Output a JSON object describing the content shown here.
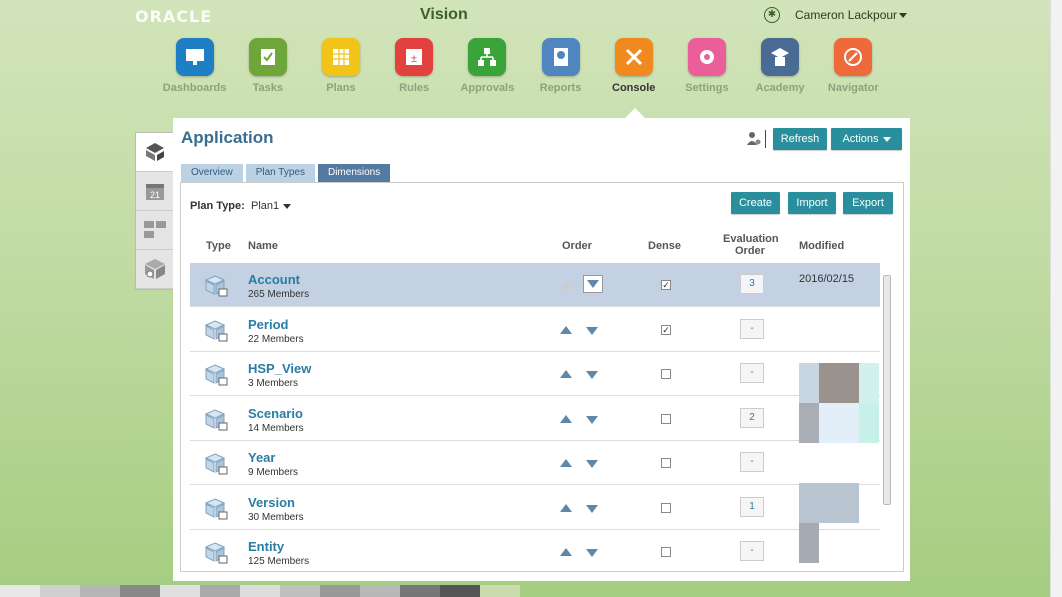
{
  "header": {
    "logo": "ORACLE",
    "app_title": "Vision",
    "user_name": "Cameron Lackpour"
  },
  "nav": [
    {
      "label": "Dashboards",
      "color": "#1f7fc4",
      "icon": "dashboard-icon"
    },
    {
      "label": "Tasks",
      "color": "#6ea63a",
      "icon": "tasks-icon"
    },
    {
      "label": "Plans",
      "color": "#f2c318",
      "icon": "plans-icon"
    },
    {
      "label": "Rules",
      "color": "#e2413e",
      "icon": "rules-icon"
    },
    {
      "label": "Approvals",
      "color": "#3aa33a",
      "icon": "approvals-icon"
    },
    {
      "label": "Reports",
      "color": "#4f86c0",
      "icon": "reports-icon"
    },
    {
      "label": "Console",
      "color": "#f08a1e",
      "icon": "console-icon",
      "active": true
    },
    {
      "label": "Settings",
      "color": "#ea5f9a",
      "icon": "settings-icon"
    },
    {
      "label": "Academy",
      "color": "#4a6b93",
      "icon": "academy-icon"
    },
    {
      "label": "Navigator",
      "color": "#ee6a3a",
      "icon": "navigator-icon"
    }
  ],
  "panel": {
    "title": "Application",
    "refresh_label": "Refresh",
    "actions_label": "Actions",
    "tabs": [
      "Overview",
      "Plan Types",
      "Dimensions"
    ],
    "active_tab": "Dimensions",
    "create_label": "Create",
    "import_label": "Import",
    "export_label": "Export",
    "plan_type_label": "Plan Type",
    "plan_type_value": "Plan1"
  },
  "grid": {
    "columns": {
      "type": "Type",
      "name": "Name",
      "order": "Order",
      "dense": "Dense",
      "eval_line1": "Evaluation",
      "eval_line2": "Order",
      "modified": "Modified"
    },
    "rows": [
      {
        "name": "Account",
        "members": "265 Members",
        "dense": true,
        "eval": "3",
        "modified": "2016/02/15",
        "selected": true
      },
      {
        "name": "Period",
        "members": "22 Members",
        "dense": true,
        "eval": "-",
        "modified": ""
      },
      {
        "name": "HSP_View",
        "members": "3 Members",
        "dense": false,
        "eval": "-",
        "modified": ""
      },
      {
        "name": "Scenario",
        "members": "14 Members",
        "dense": false,
        "eval": "2",
        "modified": ""
      },
      {
        "name": "Year",
        "members": "9 Members",
        "dense": false,
        "eval": "-",
        "modified": ""
      },
      {
        "name": "Version",
        "members": "30 Members",
        "dense": false,
        "eval": "1",
        "modified": ""
      },
      {
        "name": "Entity",
        "members": "125 Members",
        "dense": false,
        "eval": "-",
        "modified": ""
      }
    ]
  }
}
